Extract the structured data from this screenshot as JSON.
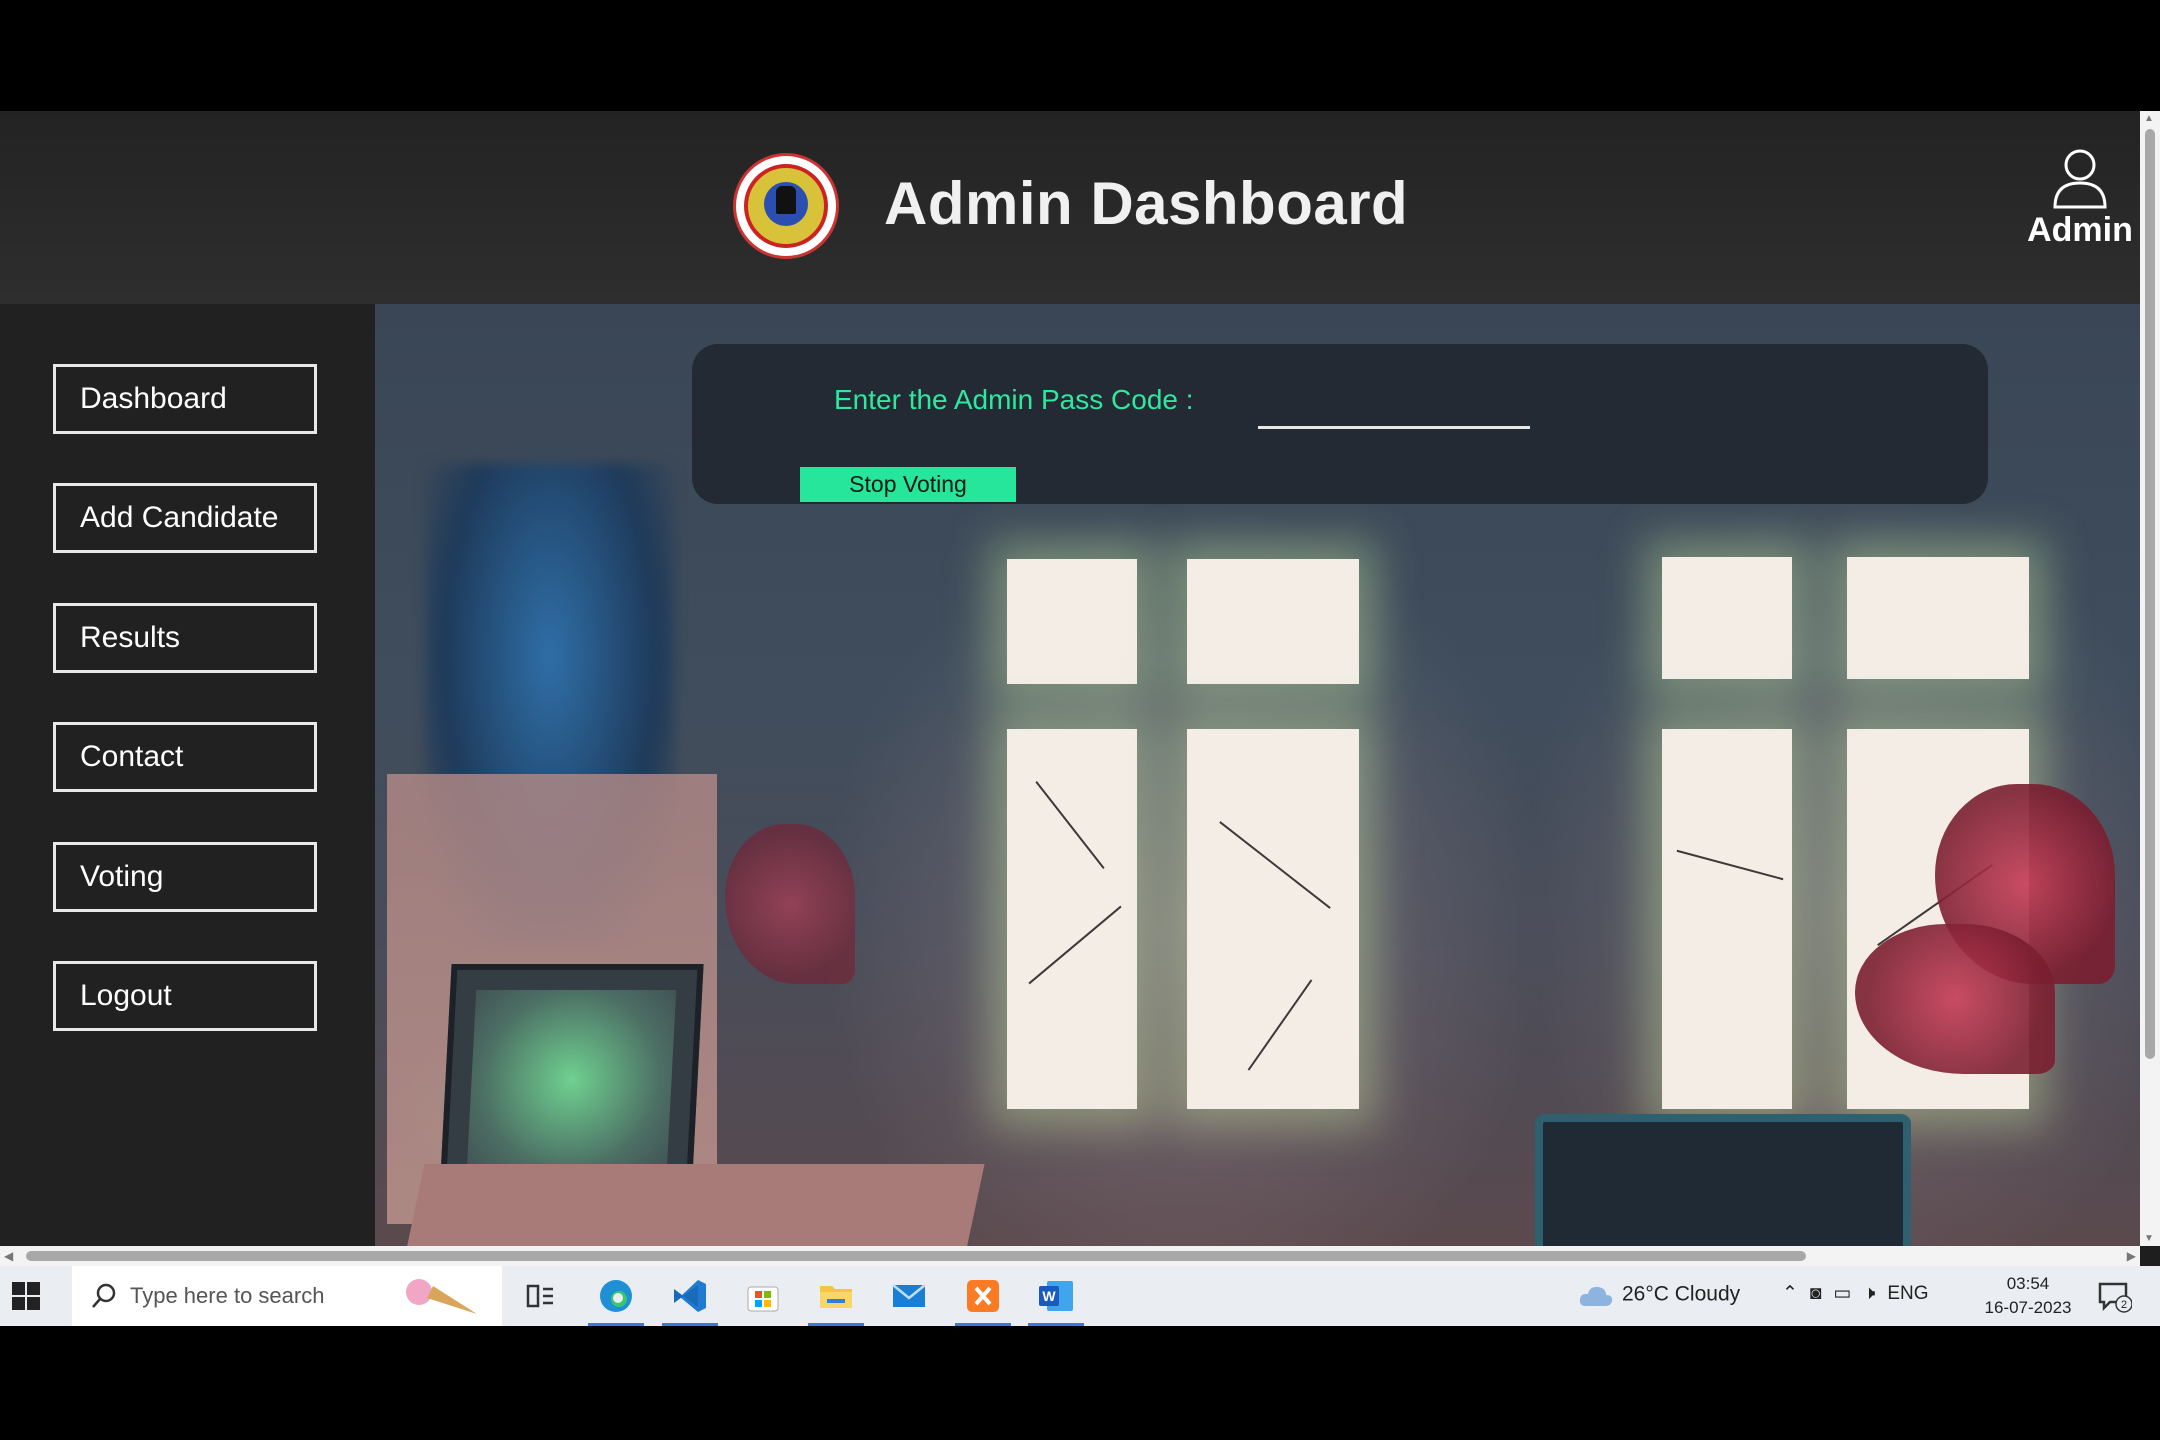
{
  "header": {
    "title": "Admin Dashboard",
    "user_label": "Admin"
  },
  "sidebar": {
    "items": [
      {
        "label": "Dashboard"
      },
      {
        "label": "Add Candidate"
      },
      {
        "label": "Results"
      },
      {
        "label": "Contact"
      },
      {
        "label": "Voting"
      },
      {
        "label": "Logout"
      }
    ]
  },
  "main": {
    "pass_label": "Enter the Admin Pass Code :",
    "pass_value": "",
    "stop_button": "Stop Voting"
  },
  "taskbar": {
    "search_placeholder": "Type here to search",
    "apps": [
      "task-view",
      "edge",
      "vscode",
      "store",
      "file-explorer",
      "mail",
      "xampp",
      "word"
    ],
    "weather": "26°C  Cloudy",
    "language": "ENG",
    "time": "03:54",
    "date": "16-07-2023",
    "notification_count": "2"
  },
  "colors": {
    "accent": "#2de89e",
    "header_bg": "#2a2a2a",
    "sidebar_bg": "#212121",
    "panel_bg": "#232a34"
  }
}
